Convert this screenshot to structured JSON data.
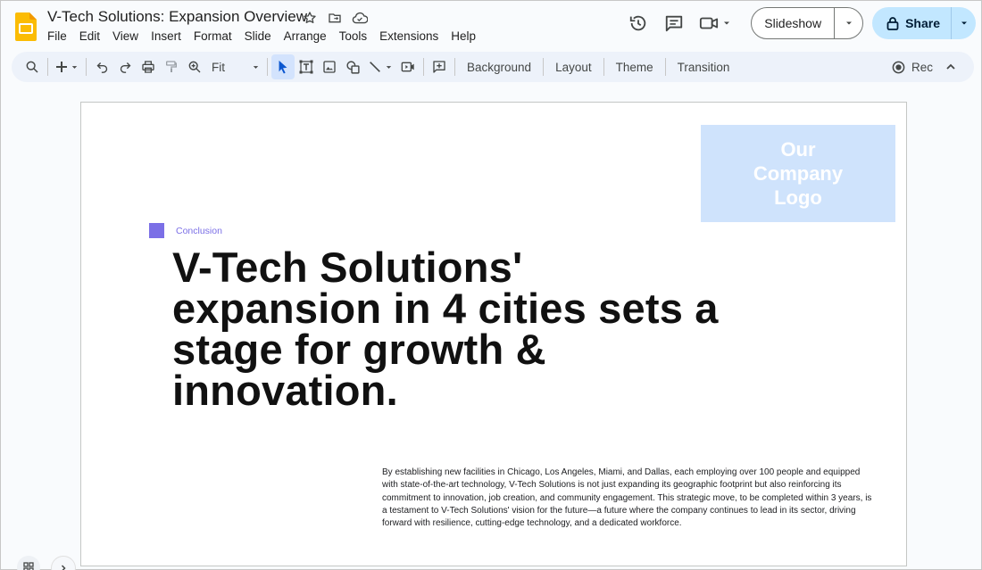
{
  "app": {
    "document_title": "V-Tech Solutions: Expansion Overview",
    "menu": [
      "File",
      "Edit",
      "View",
      "Insert",
      "Format",
      "Slide",
      "Arrange",
      "Tools",
      "Extensions",
      "Help"
    ]
  },
  "header": {
    "slideshow_label": "Slideshow",
    "share_label": "Share"
  },
  "toolbar": {
    "zoom_value": "Fit",
    "background_label": "Background",
    "layout_label": "Layout",
    "theme_label": "Theme",
    "transition_label": "Transition",
    "rec_label": "Rec"
  },
  "slide": {
    "logo_lines": [
      "Our",
      "Company",
      "Logo"
    ],
    "section_tag": "Conclusion",
    "headline": "V-Tech Solutions' expansion in 4 cities sets a stage for growth & innovation.",
    "body": "By establishing new facilities in Chicago, Los Angeles, Miami, and Dallas, each employing over 100 people and equipped with state-of-the-art technology, V-Tech Solutions is not just expanding its geographic footprint but also reinforcing its commitment to innovation, job creation, and community engagement. This strategic move, to be completed within 3 years, is a testament to V-Tech Solutions' vision for the future—a future where the company continues to lead in its sector, driving forward with resilience, cutting-edge technology, and a dedicated workforce."
  },
  "colors": {
    "accent": "#7b6fe6",
    "logo_box": "#cfe3fc",
    "share_bg": "#c2e7ff",
    "toolbar_bg": "#edf2fa"
  }
}
